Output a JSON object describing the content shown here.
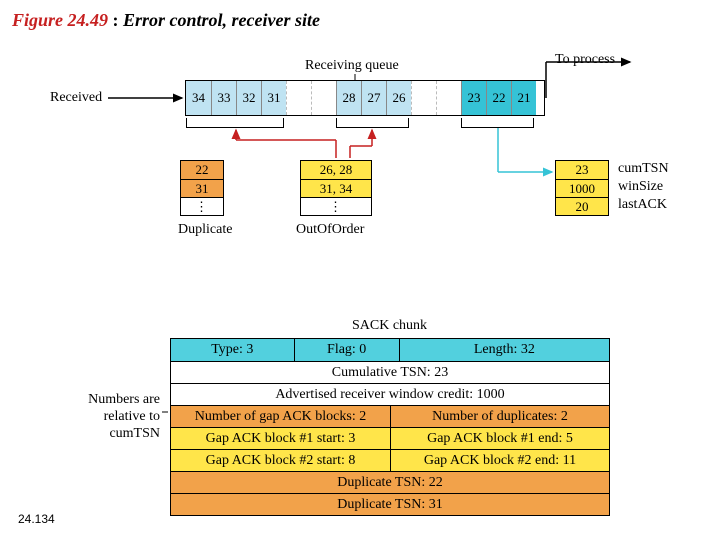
{
  "figure": {
    "number": "Figure 24.49",
    "sep": ":",
    "title": "Error control, receiver site"
  },
  "labels": {
    "received": "Received",
    "receiving_queue": "Receiving queue",
    "to_process": "To process",
    "duplicate": "Duplicate",
    "out_of_order": "OutOfOrder",
    "sack_chunk": "SACK chunk",
    "side_note_l1": "Numbers are",
    "side_note_l2": "relative to",
    "side_note_l3": "cumTSN"
  },
  "queue": {
    "slots": [
      "34",
      "33",
      "32",
      "31",
      "",
      "",
      "28",
      "27",
      "26",
      "",
      "",
      "23",
      "22",
      "21"
    ],
    "classes": [
      "filled",
      "filled",
      "filled",
      "filled",
      "gap",
      "gap",
      "filled",
      "filled",
      "filled",
      "gap",
      "gap",
      "delivered",
      "delivered",
      "delivered"
    ]
  },
  "duplicate": {
    "rows": [
      "22",
      "31"
    ],
    "color": "orange"
  },
  "out_of_order": {
    "rows": [
      "26, 28",
      "31, 34"
    ],
    "color": "yellow"
  },
  "state": {
    "fields": [
      "cumTSN",
      "winSize",
      "lastACK"
    ],
    "values": [
      "23",
      "1000",
      "20"
    ]
  },
  "sack": {
    "header": {
      "type": "Type: 3",
      "flag": "Flag: 0",
      "length": "Length: 32"
    },
    "cum": "Cumulative TSN: 23",
    "credit": "Advertised receiver window credit: 1000",
    "rows": [
      {
        "cls": "horange",
        "cells": [
          "Number of gap ACK blocks: 2",
          "Number of duplicates: 2"
        ]
      },
      {
        "cls": "hyellow",
        "cells": [
          "Gap ACK block #1 start: 3",
          "Gap ACK block #1 end: 5"
        ]
      },
      {
        "cls": "hyellow",
        "cells": [
          "Gap ACK block #2 start: 8",
          "Gap ACK block #2 end: 11"
        ]
      },
      {
        "cls": "horange",
        "cells": [
          "Duplicate TSN: 22"
        ]
      },
      {
        "cls": "horange",
        "cells": [
          "Duplicate TSN: 31"
        ]
      }
    ]
  },
  "page_number": "24.134",
  "chart_data": {
    "type": "table",
    "title": "SCTP receiver-side error control state",
    "receiving_queue_tsns": [
      34,
      33,
      32,
      31,
      null,
      null,
      28,
      27,
      26,
      null,
      null,
      23,
      22,
      21
    ],
    "delivered_tsns": [
      23,
      22,
      21
    ],
    "out_of_order_blocks": [
      [
        26,
        28
      ],
      [
        31,
        34
      ]
    ],
    "duplicate_tsns": [
      22,
      31
    ],
    "cumTSN": 23,
    "winSize": 1000,
    "lastACK": 20,
    "sack_chunk": {
      "type": 3,
      "flag": 0,
      "length": 32,
      "cumulative_tsn": 23,
      "a_rwnd": 1000,
      "num_gap_ack_blocks": 2,
      "num_duplicates": 2,
      "gap_ack_blocks_relative": [
        {
          "start": 3,
          "end": 5
        },
        {
          "start": 8,
          "end": 11
        }
      ],
      "duplicate_tsns": [
        22,
        31
      ]
    }
  }
}
